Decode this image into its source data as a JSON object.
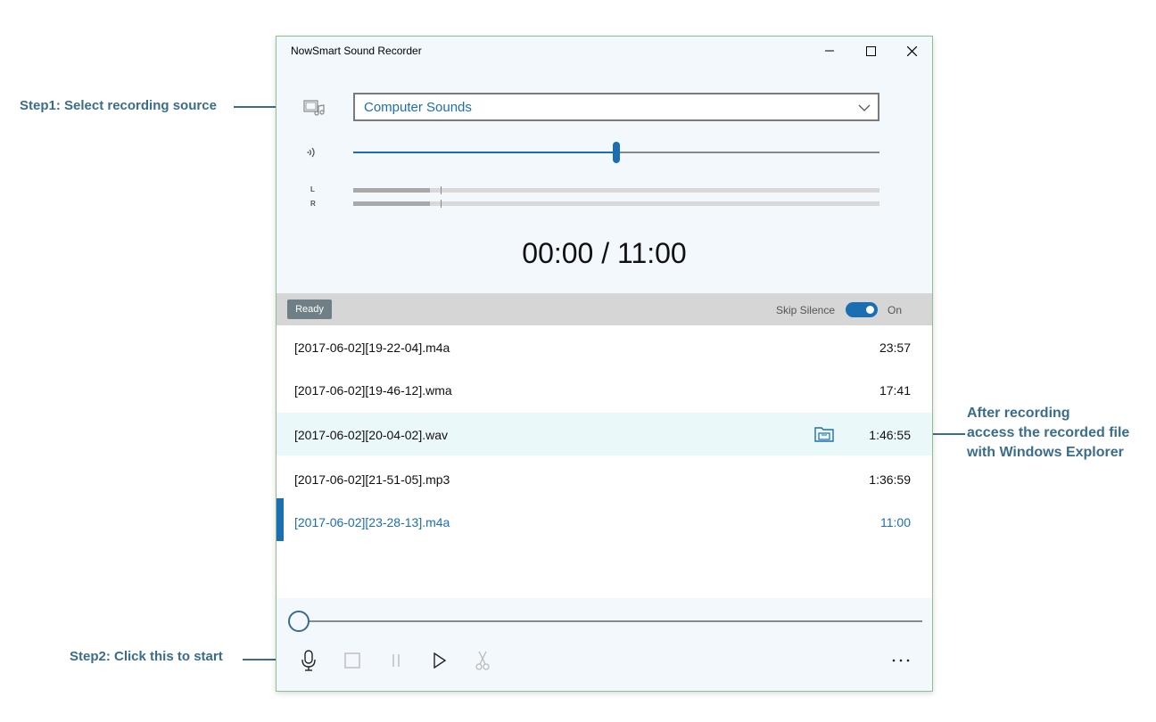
{
  "annotations": {
    "step1": "Step1: Select recording source",
    "step2": "Step2: Click this to start",
    "after_line1": "After recording",
    "after_line2": "access the recorded file",
    "after_line3": "with Windows Explorer"
  },
  "window": {
    "title": "NowSmart Sound Recorder"
  },
  "source": {
    "selected": "Computer Sounds",
    "icon": "music-source-icon"
  },
  "volume": {
    "level_fraction": 0.5,
    "icon": "speaker-icon"
  },
  "meters": {
    "left_label": "L",
    "right_label": "R",
    "left_level": 0.145,
    "right_level": 0.145
  },
  "timer": "00:00 / 11:00",
  "status": {
    "state": "Ready",
    "skip_silence_label": "Skip Silence",
    "toggle_state": "On"
  },
  "files": [
    {
      "name": "[2017-06-02][19-22-04].m4a",
      "duration": "23:57"
    },
    {
      "name": "[2017-06-02][19-46-12].wma",
      "duration": "17:41"
    },
    {
      "name": "[2017-06-02][20-04-02].wav",
      "duration": "1:46:55"
    },
    {
      "name": "[2017-06-02][21-51-05].mp3",
      "duration": "1:36:59"
    },
    {
      "name": "[2017-06-02][23-28-13].m4a",
      "duration": "11:00"
    }
  ],
  "playback": {
    "position_fraction": 0
  },
  "colors": {
    "accent": "#1a6fb3",
    "annotation": "#3a6d8c"
  }
}
